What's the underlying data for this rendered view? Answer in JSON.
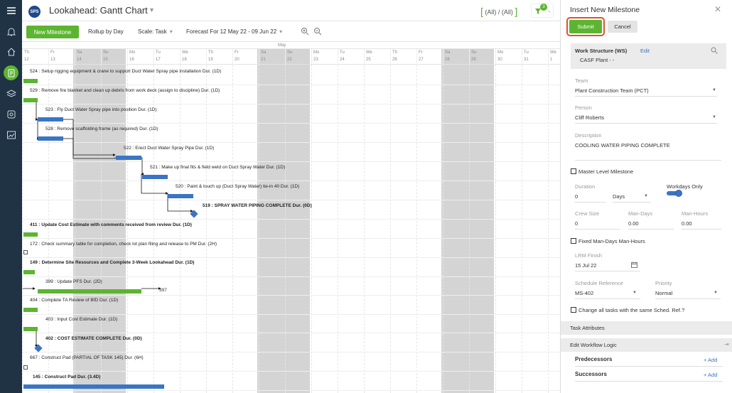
{
  "header": {
    "logo_text": "SPS",
    "title": "Lookahead: Gantt Chart",
    "filter_text": "(All) / (All)",
    "filter_badge": "3"
  },
  "toolbar": {
    "new_milestone": "New Milestone",
    "rollup": "Rollup by Day",
    "scale": "Scale: Task",
    "forecast": "Forecast For 12 May 22 - 09 Jun 22"
  },
  "timeline": {
    "month": "May",
    "days": [
      {
        "dow": "Th",
        "day": "12"
      },
      {
        "dow": "Fr",
        "day": "13"
      },
      {
        "dow": "Sa",
        "day": "14"
      },
      {
        "dow": "Su",
        "day": "15"
      },
      {
        "dow": "Mo",
        "day": "16"
      },
      {
        "dow": "Tu",
        "day": "17"
      },
      {
        "dow": "We",
        "day": "18"
      },
      {
        "dow": "Th",
        "day": "19"
      },
      {
        "dow": "Fr",
        "day": "20"
      },
      {
        "dow": "Sa",
        "day": "21"
      },
      {
        "dow": "Su",
        "day": "22"
      },
      {
        "dow": "Mo",
        "day": "23"
      },
      {
        "dow": "Tu",
        "day": "24"
      },
      {
        "dow": "We",
        "day": "25"
      },
      {
        "dow": "Th",
        "day": "26"
      },
      {
        "dow": "Fr",
        "day": "27"
      },
      {
        "dow": "Sa",
        "day": "28"
      },
      {
        "dow": "Su",
        "day": "29"
      },
      {
        "dow": "Mo",
        "day": "30"
      },
      {
        "dow": "Tu",
        "day": "31"
      },
      {
        "dow": "We",
        "day": "1"
      }
    ]
  },
  "tasks": [
    "524 : Setup rigging equipment & crane to support Duct Water Spray pipe installation Dur. (1D)",
    "529 : Remove fire blanket and clean up debris from work deck (assign to discipline) Dur. (1D)",
    "523 : Fly Duct Water Spray pipe into position Dur. (1D)",
    "528 : Remove scaffolding frame (as required) Dur. (1D)",
    "522 : Erect Duct Water Spray Pipe Dur. (1D)",
    "521 : Make up final fits & field weld on Duct Spray Water Dur. (1D)",
    "520 : Paint & touch up (Duct Spray Water) tie-in 40 Dur. (1D)",
    "519 : SPRAY WATER PIPING COMPLETE Dur. (0D)",
    "411 : Update Cost Estimate with comments received from review Dur. (1D)",
    "172 : Check summary table for completion, check lot plan filing and release to PM Dur. (2H)",
    "149 : Determine Site Resources and Complete 3-Week Lookahead Dur. (1D)",
    "399 : Update PFS Dur. (2D)",
    "404 : Complete TA Review of BfD Dur. (1D)",
    "403 : Input Cost Estimate Dur. (1D)",
    "402 : COST ESTIMATE COMPLETE Dur. (0D)",
    "667 : Construct Pad (PARTIAL OF TASK 145) Dur. (6H)",
    "145 : Construct Pad Dur. (3.4D)"
  ],
  "link_label_397": "397",
  "panel": {
    "title": "Insert New Milestone",
    "submit": "Submit",
    "cancel": "Cancel",
    "ws_label": "Work Structure (WS)",
    "ws_edit": "Edit",
    "ws_value": "CASF Plant",
    "ws_suffix": "-",
    "team_label": "Team",
    "team_value": "Plant Construction Team (PCT)",
    "person_label": "Person",
    "person_value": "Cliff Roberts",
    "desc_label": "Description",
    "desc_value": "COOLING WATER PIPING COMPLETE",
    "master_label": "Master Level Milestone",
    "duration_label": "Duration",
    "duration_value": "0",
    "duration_unit": "Days",
    "workdays_label": "Workdays Only",
    "crew_label": "Crew Size",
    "crew_value": "0",
    "mandays_label": "Man-Days",
    "mandays_value": "0.00",
    "manhours_label": "Man-Hours",
    "manhours_value": "0.00",
    "fixed_label": "Fixed Man-Days Man-Hours",
    "lrm_label": "LRM Finish",
    "lrm_value": "15 Jul 22",
    "sched_label": "Schedule Reference",
    "sched_value": "MS-402",
    "priority_label": "Priority",
    "priority_value": "Normal",
    "change_label": "Change all tasks with the same Sched. Ref.?",
    "task_attr": "Task Attributes",
    "workflow": "Edit Workflow Logic",
    "pred": "Predecessors",
    "succ": "Successors",
    "add": "+ Add"
  },
  "colors": {
    "accent_green": "#5cb531",
    "bar_blue": "#3a75c4",
    "rail": "#1f3345",
    "highlight": "#e2502a"
  }
}
